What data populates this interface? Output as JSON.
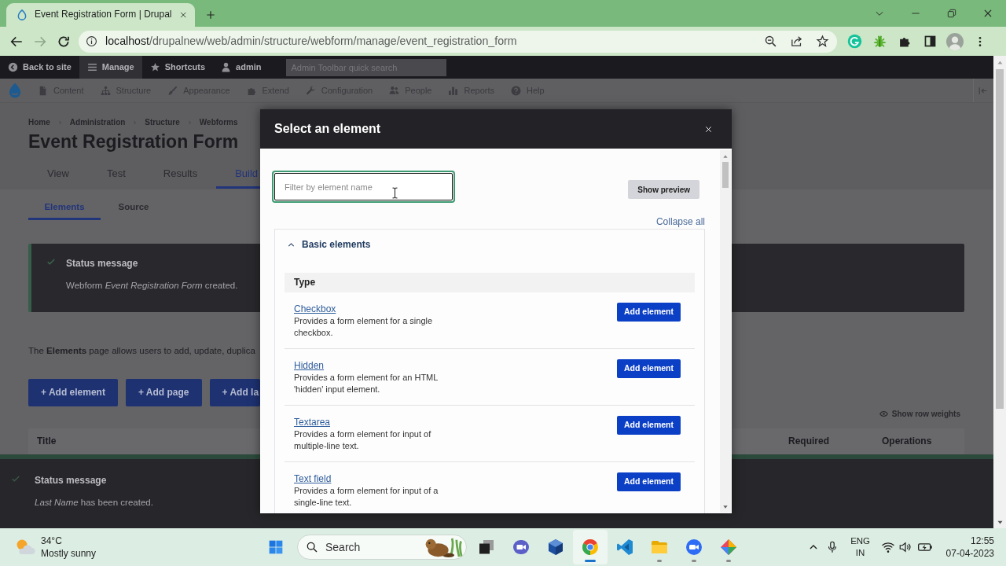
{
  "browser": {
    "tab": {
      "title": "Event Registration Form | Drupal"
    },
    "navigation": [
      {
        "disabled": false
      },
      {
        "disabled": true
      },
      {
        "disabled": false
      }
    ],
    "address": {
      "host": "localhost",
      "path": "/drupalnew/web/admin/structure/webform/manage/event_registration_form"
    }
  },
  "admin_toolbar": {
    "items": [
      {
        "label": "Back to site",
        "selected": false
      },
      {
        "label": "Manage",
        "selected": true
      },
      {
        "label": "Shortcuts",
        "selected": false
      },
      {
        "label": "admin",
        "selected": false
      }
    ],
    "search": {
      "placeholder": "Admin Toolbar quick search"
    }
  },
  "admin_menu": {
    "items": [
      {
        "label": "Content"
      },
      {
        "label": "Structure"
      },
      {
        "label": "Appearance"
      },
      {
        "label": "Extend"
      },
      {
        "label": "Configuration"
      },
      {
        "label": "People"
      },
      {
        "label": "Reports"
      },
      {
        "label": "Help"
      }
    ]
  },
  "page": {
    "breadcrumb": [
      "Home",
      "Administration",
      "Structure",
      "Webforms"
    ],
    "title": "Event Registration Form",
    "tabs": [
      {
        "label": "View",
        "selected": false
      },
      {
        "label": "Test",
        "selected": false
      },
      {
        "label": "Results",
        "selected": false
      },
      {
        "label": "Build",
        "selected": true
      }
    ],
    "subtabs": [
      {
        "label": "Elements",
        "selected": true
      },
      {
        "label": "Source",
        "selected": false
      }
    ],
    "status_message": {
      "title": "Status message",
      "text": "Webform *Event Registration Form* created."
    },
    "description": "The **Elements** page allows users to add, update, duplica",
    "buttons": [
      "+ Add element",
      "+ Add page",
      "+ Add la"
    ],
    "row_weights_link": "Show row weights",
    "table": {
      "columns": [
        "Title",
        "Required",
        "Operations"
      ]
    }
  },
  "bottom_status": {
    "title": "Status message",
    "text": "*Last Name* has been created."
  },
  "dialog": {
    "title": "Select an element",
    "filter": {
      "placeholder": "Filter by element name"
    },
    "preview_button": "Show preview",
    "collapse_link": "Collapse all",
    "group": {
      "title": "Basic elements",
      "expanded": true,
      "column": "Type",
      "rows": [
        {
          "name": "Checkbox",
          "description": "Provides a form element for a single checkbox.",
          "button": "Add element"
        },
        {
          "name": "Hidden",
          "description": "Provides a form element for an HTML 'hidden' input element.",
          "button": "Add element"
        },
        {
          "name": "Textarea",
          "description": "Provides a form element for input of multiple-line text.",
          "button": "Add element"
        },
        {
          "name": "Text field",
          "description": "Provides a form element for input of a single-line text.",
          "button": "Add element"
        }
      ]
    }
  },
  "taskbar": {
    "weather": {
      "temperature": "34°C",
      "condition": "Mostly sunny"
    },
    "search": {
      "placeholder": "Search"
    },
    "apps": [
      {
        "running": false,
        "focused": false
      },
      {
        "running": false,
        "focused": false
      },
      {
        "running": false,
        "focused": false
      },
      {
        "running": true,
        "focused": true
      },
      {
        "running": false,
        "focused": false
      },
      {
        "running": true,
        "focused": false
      },
      {
        "running": true,
        "focused": false
      },
      {
        "running": true,
        "focused": false
      }
    ],
    "language": {
      "code": "ENG",
      "region": "IN"
    },
    "clock": {
      "time": "12:55",
      "date": "07-04-2023"
    }
  }
}
